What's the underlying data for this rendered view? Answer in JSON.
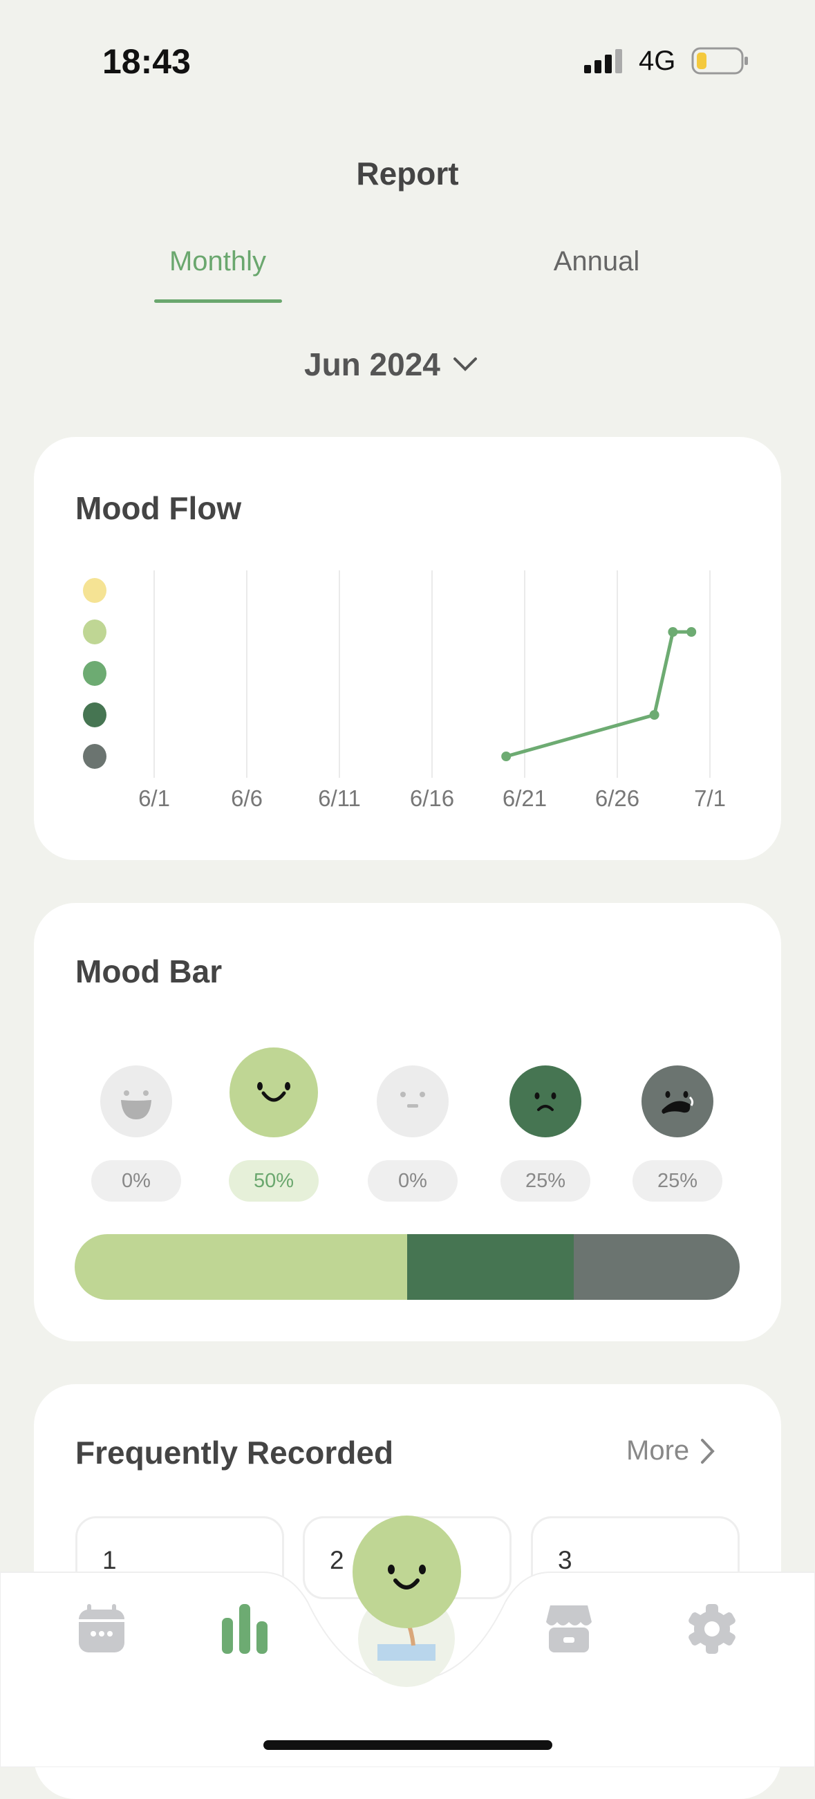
{
  "status_bar": {
    "time": "18:43",
    "network": "4G",
    "battery_level": 0.2
  },
  "header": {
    "title": "Report"
  },
  "tabs": [
    {
      "label": "Monthly",
      "active": true
    },
    {
      "label": "Annual",
      "active": false
    }
  ],
  "month_selector": {
    "value": "Jun 2024"
  },
  "mood_flow": {
    "title": "Mood Flow"
  },
  "chart_data": {
    "type": "line",
    "x_ticks": [
      "6/1",
      "6/6",
      "6/11",
      "6/16",
      "6/21",
      "6/26",
      "7/1"
    ],
    "y_levels": [
      {
        "level": 5,
        "color": "#f5e394"
      },
      {
        "level": 4,
        "color": "#bfd694"
      },
      {
        "level": 3,
        "color": "#6dab72"
      },
      {
        "level": 2,
        "color": "#467552"
      },
      {
        "level": 1,
        "color": "#6b7470"
      }
    ],
    "points": [
      {
        "x": "6/20",
        "y": 1
      },
      {
        "x": "6/28",
        "y": 2
      },
      {
        "x": "6/29",
        "y": 4
      },
      {
        "x": "6/30",
        "y": 4
      }
    ],
    "xlim": [
      "6/1",
      "7/1"
    ],
    "ylim": [
      1,
      5
    ],
    "grid": "vertical",
    "line_color": "#6dab72"
  },
  "mood_bar": {
    "title": "Mood Bar",
    "moods": [
      {
        "name": "great",
        "percent": "0%",
        "value": 0,
        "color": "#ececec"
      },
      {
        "name": "good",
        "percent": "50%",
        "value": 50,
        "color": "#bfd694",
        "selected": true
      },
      {
        "name": "okay",
        "percent": "0%",
        "value": 0,
        "color": "#ececec"
      },
      {
        "name": "bad",
        "percent": "25%",
        "value": 25,
        "color": "#467552"
      },
      {
        "name": "awful",
        "percent": "25%",
        "value": 25,
        "color": "#6b7470"
      }
    ]
  },
  "frequently_recorded": {
    "title": "Frequently Recorded",
    "more_label": "More",
    "ranks": [
      "1",
      "2",
      "3"
    ]
  },
  "bottom_nav": {
    "items": [
      "calendar",
      "report",
      "home-mood",
      "store",
      "settings"
    ],
    "active": "report"
  }
}
